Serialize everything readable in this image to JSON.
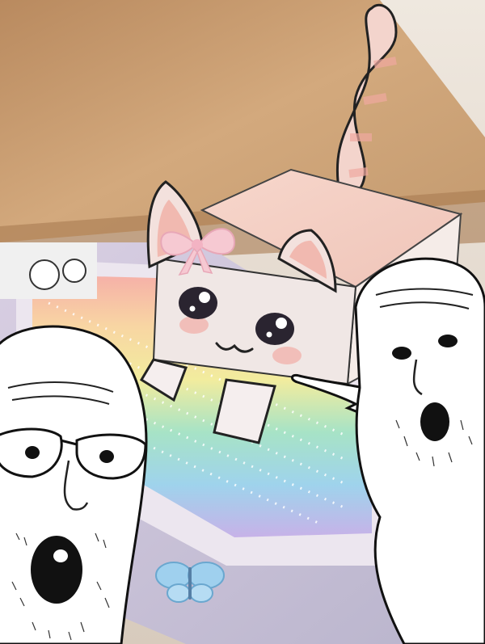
{
  "image": {
    "kind": "meme",
    "subject": "paper-craft-cat-box",
    "reaction": "two-pointing-soyjaks"
  },
  "colors": {
    "background_wood": "#c89a68",
    "paper_cat": "#f0ddd6",
    "cat_pink": "#f1b9b0",
    "bow": "#f6c9d2",
    "outline": "#222222"
  }
}
